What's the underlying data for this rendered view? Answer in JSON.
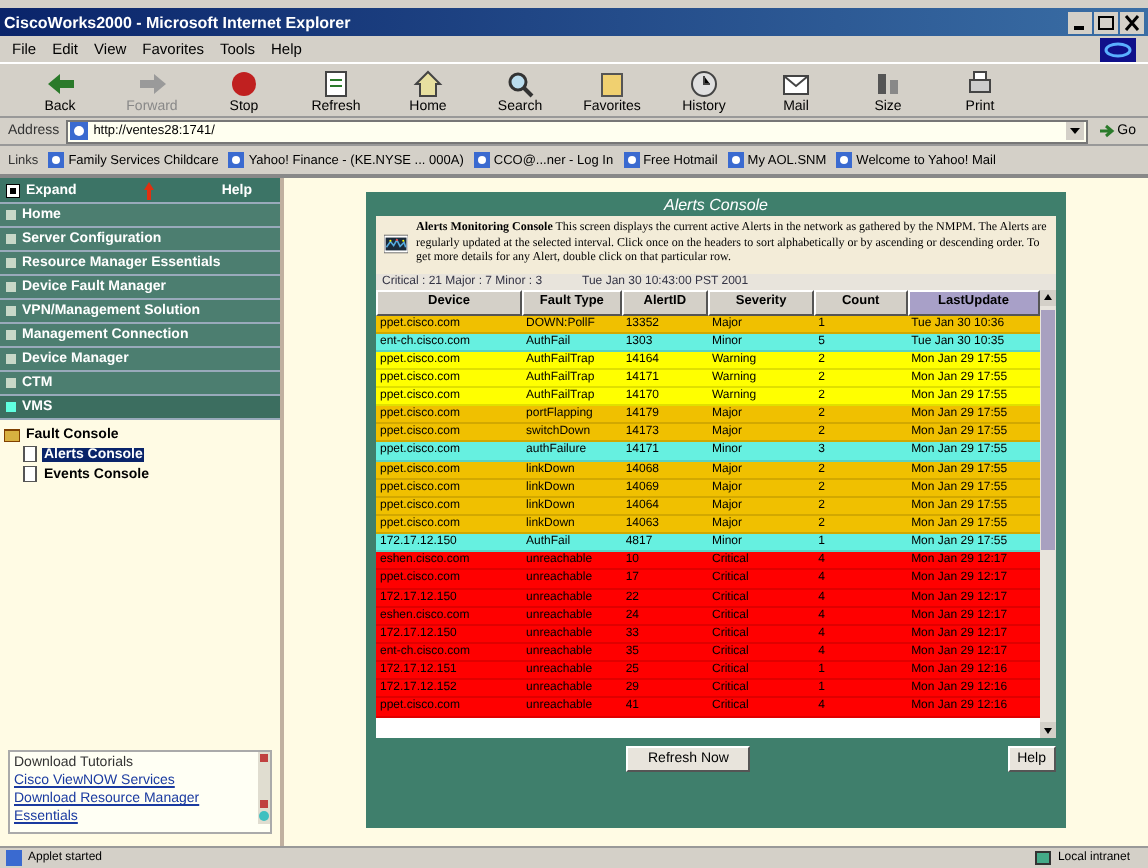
{
  "window": {
    "title": "CiscoWorks2000 - Microsoft Internet Explorer"
  },
  "menu": [
    "File",
    "Edit",
    "View",
    "Favorites",
    "Tools",
    "Help"
  ],
  "toolbar": [
    {
      "label": "Back",
      "kind": "back",
      "disabled": false
    },
    {
      "label": "Forward",
      "kind": "forward",
      "disabled": true
    },
    {
      "label": "Stop",
      "kind": "stop",
      "disabled": false
    },
    {
      "label": "Refresh",
      "kind": "refresh",
      "disabled": false
    },
    {
      "label": "Home",
      "kind": "home",
      "disabled": false
    },
    {
      "label": "Search",
      "kind": "search",
      "disabled": false
    },
    {
      "label": "Favorites",
      "kind": "favorites",
      "disabled": false
    },
    {
      "label": "History",
      "kind": "history",
      "disabled": false
    },
    {
      "label": "Mail",
      "kind": "mail",
      "disabled": false
    },
    {
      "label": "Size",
      "kind": "size",
      "disabled": false
    },
    {
      "label": "Print",
      "kind": "print",
      "disabled": false
    }
  ],
  "address": {
    "label": "Address",
    "value": "http://ventes28:1741/",
    "go": "Go"
  },
  "links": {
    "label": "Links",
    "items": [
      "Family Services Childcare",
      "Yahoo! Finance - (KE.NYSE ... 000A)",
      "CCO@...ner - Log In",
      "Free Hotmail",
      "My AOL.SNM",
      "Welcome to Yahoo! Mail"
    ]
  },
  "sidebar": {
    "expand": "Expand",
    "help": "Help",
    "items": [
      {
        "label": "Home",
        "selected": false
      },
      {
        "label": "Server Configuration",
        "selected": false
      },
      {
        "label": "Resource Manager Essentials",
        "selected": false
      },
      {
        "label": "Device Fault Manager",
        "selected": false
      },
      {
        "label": "VPN/Management Solution",
        "selected": false
      },
      {
        "label": "Management Connection",
        "selected": false
      },
      {
        "label": "Device Manager",
        "selected": false
      },
      {
        "label": "CTM",
        "selected": false
      },
      {
        "label": "VMS",
        "selected": true
      }
    ],
    "tree": [
      {
        "label": "Fault Console",
        "selected": false,
        "children": [
          {
            "label": "Alerts Console",
            "selected": true
          },
          {
            "label": "Events Console",
            "selected": false
          }
        ]
      }
    ],
    "resources": [
      "Download Tutorials",
      "Cisco ViewNOW Services",
      "Download Resource Manager",
      "Essentials"
    ]
  },
  "console": {
    "title": "Alerts Console",
    "intro_title": "Alerts Monitoring Console",
    "intro": "This screen displays the current active Alerts in the network as gathered by the NMPM. The Alerts are regularly updated at the selected interval. Click once on the headers to sort alphabetically or by ascending or descending order. To get more details for any Alert, double click on that particular row.",
    "summary": "Critical : 21 Major : 7 Minor : 3",
    "timestamp": "Tue Jan 30 10:43:00 PST 2001",
    "columns": [
      {
        "label": "Device",
        "selected": false
      },
      {
        "label": "Fault Type",
        "selected": false
      },
      {
        "label": "AlertID",
        "selected": false
      },
      {
        "label": "Severity",
        "selected": false
      },
      {
        "label": "Count",
        "selected": false
      },
      {
        "label": "LastUpdate",
        "selected": true
      }
    ],
    "rows": [
      {
        "color": "#f0c000",
        "cells": [
          "ppet.cisco.com",
          "DOWN:PollF",
          "13352",
          "Major",
          "1",
          "Tue Jan 30 10:36"
        ]
      },
      {
        "color": "#66f0e0",
        "cells": [
          "ent-ch.cisco.com",
          "AuthFail",
          "1303",
          "Minor",
          "5",
          "Tue Jan 30 10:35"
        ]
      },
      {
        "color": "#ffff00",
        "cells": [
          "ppet.cisco.com",
          "AuthFailTrap",
          "14164",
          "Warning",
          "2",
          "Mon Jan 29 17:55"
        ]
      },
      {
        "color": "#ffff00",
        "cells": [
          "ppet.cisco.com",
          "AuthFailTrap",
          "14171",
          "Warning",
          "2",
          "Mon Jan 29 17:55"
        ]
      },
      {
        "color": "#ffff00",
        "cells": [
          "ppet.cisco.com",
          "AuthFailTrap",
          "14170",
          "Warning",
          "2",
          "Mon Jan 29 17:55"
        ]
      },
      {
        "color": "#f0c000",
        "cells": [
          "ppet.cisco.com",
          "portFlapping",
          "14179",
          "Major",
          "2",
          "Mon Jan 29 17:55"
        ]
      },
      {
        "color": "#f0c000",
        "cells": [
          "ppet.cisco.com",
          "switchDown",
          "14173",
          "Major",
          "2",
          "Mon Jan 29 17:55"
        ]
      },
      {
        "color": "#66f0e0",
        "cells": [
          "ppet.cisco.com",
          "authFailure",
          "14171",
          "Minor",
          "3",
          "Mon Jan 29 17:55"
        ]
      },
      {
        "color": "#f0c000",
        "cells": [
          "ppet.cisco.com",
          "linkDown",
          "14068",
          "Major",
          "2",
          "Mon Jan 29 17:55"
        ]
      },
      {
        "color": "#f0c000",
        "cells": [
          "ppet.cisco.com",
          "linkDown",
          "14069",
          "Major",
          "2",
          "Mon Jan 29 17:55"
        ]
      },
      {
        "color": "#f0c000",
        "cells": [
          "ppet.cisco.com",
          "linkDown",
          "14064",
          "Major",
          "2",
          "Mon Jan 29 17:55"
        ]
      },
      {
        "color": "#f0c000",
        "cells": [
          "ppet.cisco.com",
          "linkDown",
          "14063",
          "Major",
          "2",
          "Mon Jan 29 17:55"
        ]
      },
      {
        "color": "#66f0e0",
        "cells": [
          "172.17.12.150",
          "AuthFail",
          "4817",
          "Minor",
          "1",
          "Mon Jan 29 17:55"
        ]
      },
      {
        "color": "#ff0000",
        "cells": [
          "eshen.cisco.com",
          "unreachable",
          "10",
          "Critical",
          "4",
          "Mon Jan 29 12:17"
        ]
      },
      {
        "color": "#ff0000",
        "cells": [
          "ppet.cisco.com",
          "unreachable",
          "17",
          "Critical",
          "4",
          "Mon Jan 29 12:17"
        ]
      },
      {
        "color": "#ff0000",
        "cells": [
          "172.17.12.150",
          "unreachable",
          "22",
          "Critical",
          "4",
          "Mon Jan 29 12:17"
        ]
      },
      {
        "color": "#ff0000",
        "cells": [
          "eshen.cisco.com",
          "unreachable",
          "24",
          "Critical",
          "4",
          "Mon Jan 29 12:17"
        ]
      },
      {
        "color": "#ff0000",
        "cells": [
          "172.17.12.150",
          "unreachable",
          "33",
          "Critical",
          "4",
          "Mon Jan 29 12:17"
        ]
      },
      {
        "color": "#ff0000",
        "cells": [
          "ent-ch.cisco.com",
          "unreachable",
          "35",
          "Critical",
          "4",
          "Mon Jan 29 12:17"
        ]
      },
      {
        "color": "#ff0000",
        "cells": [
          "172.17.12.151",
          "unreachable",
          "25",
          "Critical",
          "1",
          "Mon Jan 29 12:16"
        ]
      },
      {
        "color": "#ff0000",
        "cells": [
          "172.17.12.152",
          "unreachable",
          "29",
          "Critical",
          "1",
          "Mon Jan 29 12:16"
        ]
      },
      {
        "color": "#ff0000",
        "cells": [
          "ppet.cisco.com",
          "unreachable",
          "41",
          "Critical",
          "4",
          "Mon Jan 29 12:16"
        ]
      }
    ],
    "buttons": [
      {
        "label": "Refresh Now",
        "kind": "refresh"
      },
      {
        "label": "Help",
        "kind": "help"
      }
    ]
  },
  "status_bar": {
    "left": "Applet started",
    "right": "Local intranet"
  }
}
